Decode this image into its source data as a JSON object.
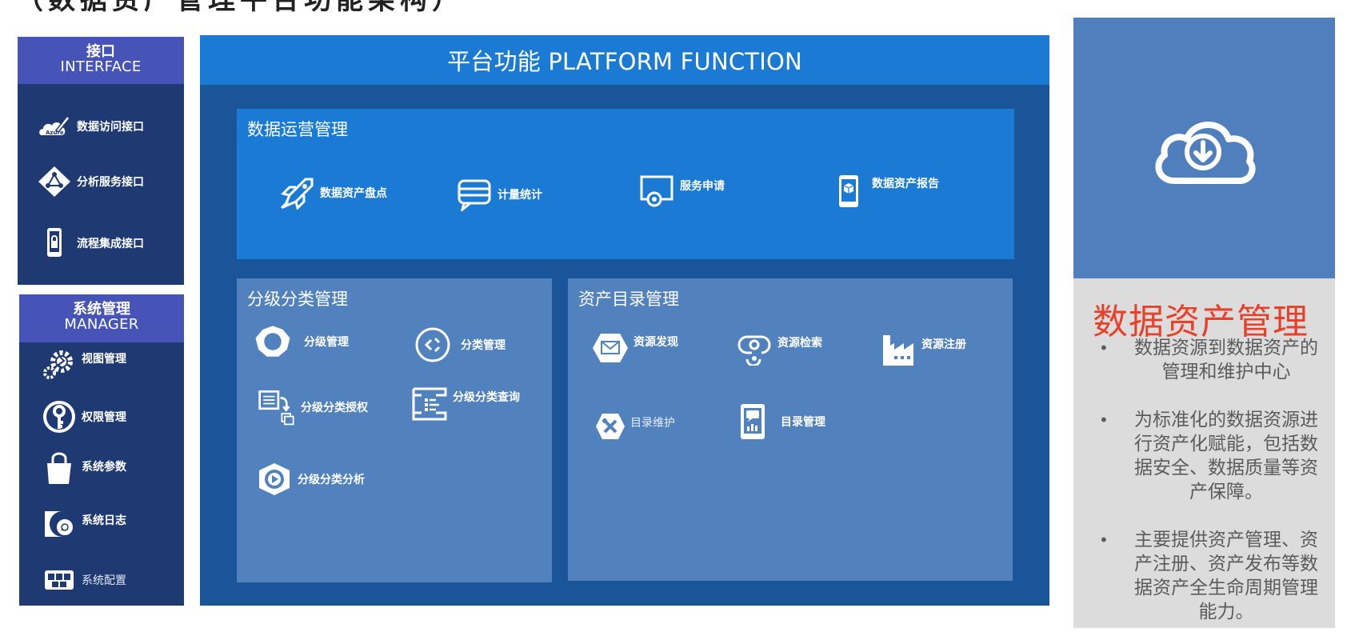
{
  "page_title": "（数据资产管理平台功能架构）",
  "interface_panel": {
    "title_zh": "接口",
    "title_en": "INTERFACE",
    "items": [
      {
        "label": "数据访问接口",
        "icon": "azure-pen-icon"
      },
      {
        "label": "分析服务接口",
        "icon": "diamond-network-icon"
      },
      {
        "label": "流程集成接口",
        "icon": "phone-lock-icon"
      }
    ]
  },
  "manager_panel": {
    "title_zh": "系统管理",
    "title_en": "MANAGER",
    "items": [
      {
        "label": "视图管理",
        "icon": "gears-icon"
      },
      {
        "label": "权限管理",
        "icon": "key-icon"
      },
      {
        "label": "系统参数",
        "icon": "shopping-bag-icon"
      },
      {
        "label": "系统日志",
        "icon": "disc-log-icon"
      },
      {
        "label": "系统配置",
        "icon": "config-boxes-icon"
      }
    ]
  },
  "platform": {
    "title": "平台功能 PLATFORM FUNCTION",
    "operations": {
      "title": "数据运营管理",
      "items": [
        {
          "label": "数据资产盘点",
          "icon": "rocket-icon"
        },
        {
          "label": "计量统计",
          "icon": "chat-lines-icon"
        },
        {
          "label": "服务申请",
          "icon": "screen-cursor-icon"
        },
        {
          "label": "数据资产报告",
          "icon": "tablet-cube-icon"
        }
      ]
    },
    "classification": {
      "title": "分级分类管理",
      "items": [
        {
          "label": "分级管理",
          "icon": "ring-icon"
        },
        {
          "label": "分类管理",
          "icon": "circle-arrows-icon"
        },
        {
          "label": "分级分类授权",
          "icon": "document-copy-icon"
        },
        {
          "label": "分级分类查询",
          "icon": "list-bracket-icon"
        },
        {
          "label": "分级分类分析",
          "icon": "eye-play-icon"
        }
      ]
    },
    "catalog": {
      "title": "资产目录管理",
      "items": [
        {
          "label": "资源发现",
          "icon": "hexagon-mail-icon"
        },
        {
          "label": "资源检索",
          "icon": "link-icon"
        },
        {
          "label": "资源注册",
          "icon": "factory-icon"
        },
        {
          "label": "目录维护",
          "icon": "hexagon-tools-icon"
        },
        {
          "label": "目录管理",
          "icon": "tablet-chart-icon"
        }
      ]
    }
  },
  "right_panel": {
    "icon": "cloud-download-icon",
    "title": "数据资产管理",
    "bullets": [
      "数据资源到数据资产的管理和维护中心",
      "为标准化的数据资源进行资产化赋能，包括数据安全、数据质量等资产保障。",
      "主要提供资产管理、资产注册、资产发布等数据资产全生命周期管理能力。"
    ]
  },
  "colors": {
    "interface_bg": "#1f3a73",
    "panel_header": "#4654b8",
    "platform_bg": "#1a5499",
    "platform_header": "#1a7ad4",
    "operations_bg": "#1a7ad4",
    "sub_box_bg": "#5282bd",
    "right_top": "#4f80bd",
    "right_bottom": "#dcdcdc",
    "title_red": "#e8412a"
  }
}
